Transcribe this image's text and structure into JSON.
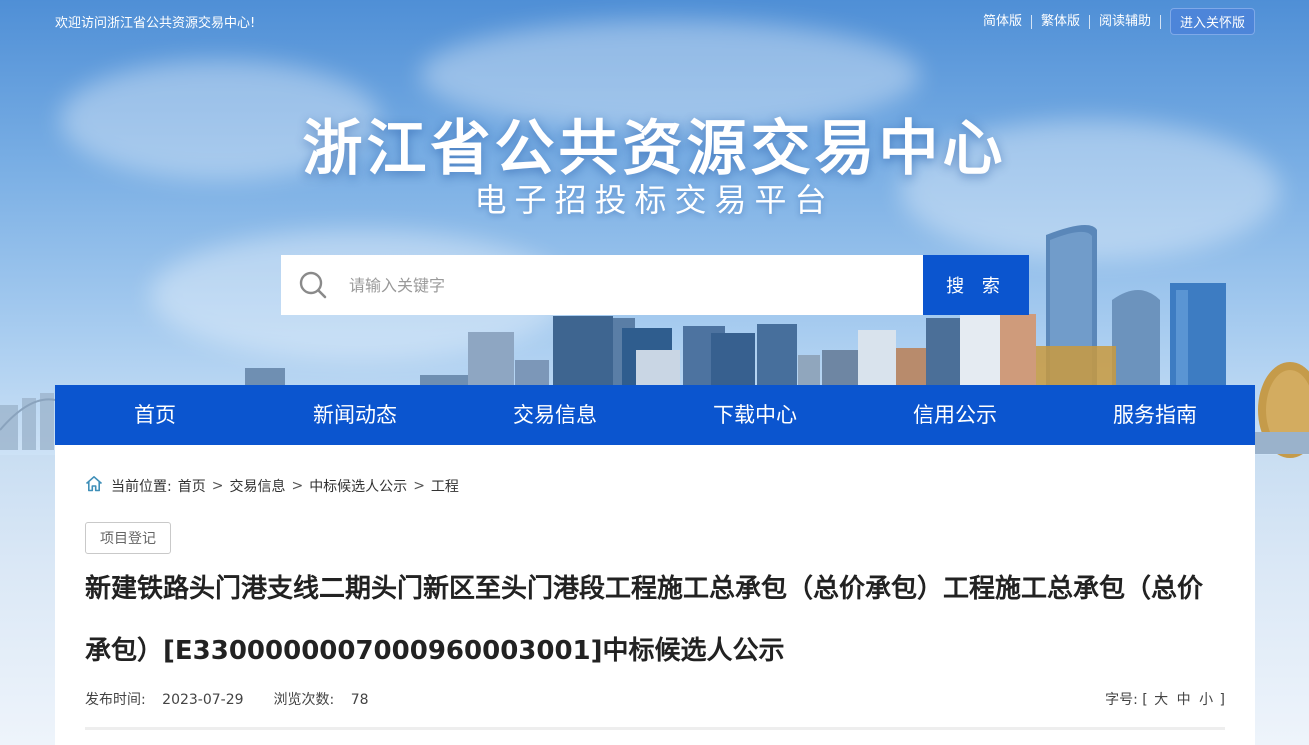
{
  "topbar": {
    "welcome": "欢迎访问浙江省公共资源交易中心!",
    "links": [
      "简体版",
      "繁体版",
      "阅读辅助"
    ],
    "care_button": "进入关怀版"
  },
  "header": {
    "title": "浙江省公共资源交易中心",
    "subtitle": "电子招投标交易平台"
  },
  "search": {
    "placeholder": "请输入关键字",
    "button": "搜 索"
  },
  "nav": {
    "items": [
      "首页",
      "新闻动态",
      "交易信息",
      "下载中心",
      "信用公示",
      "服务指南"
    ]
  },
  "breadcrumb": {
    "prefix": "当前位置:",
    "items": [
      "首页",
      "交易信息",
      "中标候选人公示",
      "工程"
    ],
    "separator": ">"
  },
  "article": {
    "tag": "项目登记",
    "title": "新建铁路头门港支线二期头门新区至头门港段工程施工总承包（总价承包）工程施工总承包（总价承包）[E3300000007000960003001]中标候选人公示",
    "publish_label": "发布时间:",
    "publish_date": "2023-07-29",
    "views_label": "浏览次数:",
    "views": "78",
    "fontsize_label": "字号:",
    "fontsize_open": "[",
    "fontsize_options": [
      "大",
      "中",
      "小"
    ],
    "fontsize_close": "]"
  },
  "colors": {
    "brand_blue": "#0b55cf",
    "care_button": "#4d85d9"
  }
}
